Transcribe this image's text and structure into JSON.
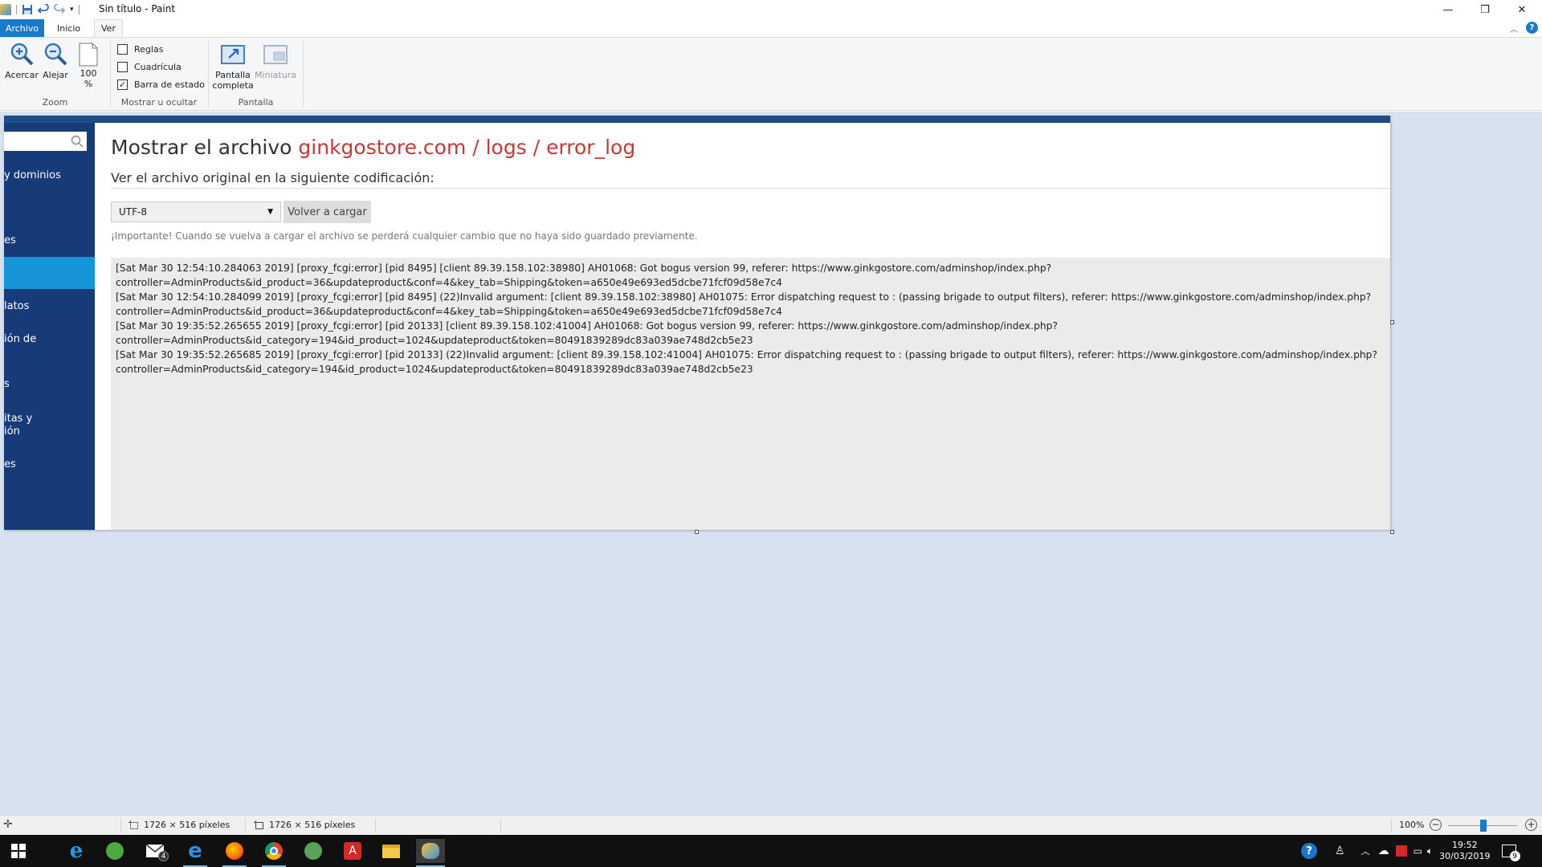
{
  "window": {
    "title": "Sin título - Paint"
  },
  "tabs": [
    {
      "label": "Archivo"
    },
    {
      "label": "Inicio"
    },
    {
      "label": "Ver"
    }
  ],
  "ribbon": {
    "zoom_in_label": "Acercar",
    "zoom_out_label": "Alejar",
    "zoom_100_line1": "100",
    "zoom_100_line2": "%",
    "zoom_group_label": "Zoom",
    "rulers_label": "Reglas",
    "grid_label": "Cuadrícula",
    "statusbar_label": "Barra de estado",
    "showhide_group_label": "Mostrar u ocultar",
    "fullscreen_line1": "Pantalla",
    "fullscreen_line2": "completa",
    "thumbnail_label": "Miniatura",
    "screen_group_label": "Pantalla"
  },
  "sidebar": {
    "items": [
      "y dominios",
      "es",
      "latos",
      "ión de",
      "s",
      "itas y",
      "ión",
      "es"
    ]
  },
  "page": {
    "title_prefix": "Mostrar el archivo",
    "title_path": "ginkgostore.com / logs / error_log",
    "subtitle": "Ver el archivo original en la siguiente codificación:",
    "encoding_value": "UTF-8",
    "reload_label": "Volver a cargar",
    "note": "¡Importante! Cuando se vuelva a cargar el archivo se perderá cualquier cambio que no haya sido guardado previamente.",
    "log_lines": [
      "[Sat Mar 30 12:54:10.284063 2019] [proxy_fcgi:error] [pid 8495] [client 89.39.158.102:38980] AH01068: Got bogus version 99, referer: https://www.ginkgostore.com/adminshop/index.php?",
      "controller=AdminProducts&id_product=36&updateproduct&conf=4&key_tab=Shipping&token=a650e49e693ed5dcbe71fcf09d58e7c4",
      "[Sat Mar 30 12:54:10.284099 2019] [proxy_fcgi:error] [pid 8495] (22)Invalid argument: [client 89.39.158.102:38980] AH01075: Error dispatching request to : (passing brigade to output filters), referer: https://www.ginkgostore.com/adminshop/index.php?",
      "controller=AdminProducts&id_product=36&updateproduct&conf=4&key_tab=Shipping&token=a650e49e693ed5dcbe71fcf09d58e7c4",
      "[Sat Mar 30 19:35:52.265655 2019] [proxy_fcgi:error] [pid 20133] [client 89.39.158.102:41004] AH01068: Got bogus version 99, referer: https://www.ginkgostore.com/adminshop/index.php?",
      "controller=AdminProducts&id_category=194&id_product=1024&updateproduct&token=80491839289dc83a039ae748d2cb5e23",
      "[Sat Mar 30 19:35:52.265685 2019] [proxy_fcgi:error] [pid 20133] (22)Invalid argument: [client 89.39.158.102:41004] AH01075: Error dispatching request to : (passing brigade to output filters), referer: https://www.ginkgostore.com/adminshop/index.php?",
      "controller=AdminProducts&id_category=194&id_product=1024&updateproduct&token=80491839289dc83a039ae748d2cb5e23"
    ]
  },
  "statusbar": {
    "selection_size": "1726 × 516 píxeles",
    "image_size": "1726 × 516 píxeles",
    "zoom_level": "100%"
  },
  "taskbar": {
    "time": "19:52",
    "date": "30/03/2019",
    "mail_badge": "4",
    "notification_count": "9"
  },
  "colors": {
    "accent": "#1979ca",
    "sidebar": "#173a78",
    "sidebar_active": "#1594d8",
    "title_path": "#c33a3a",
    "workspace": "#d7e1ef"
  }
}
